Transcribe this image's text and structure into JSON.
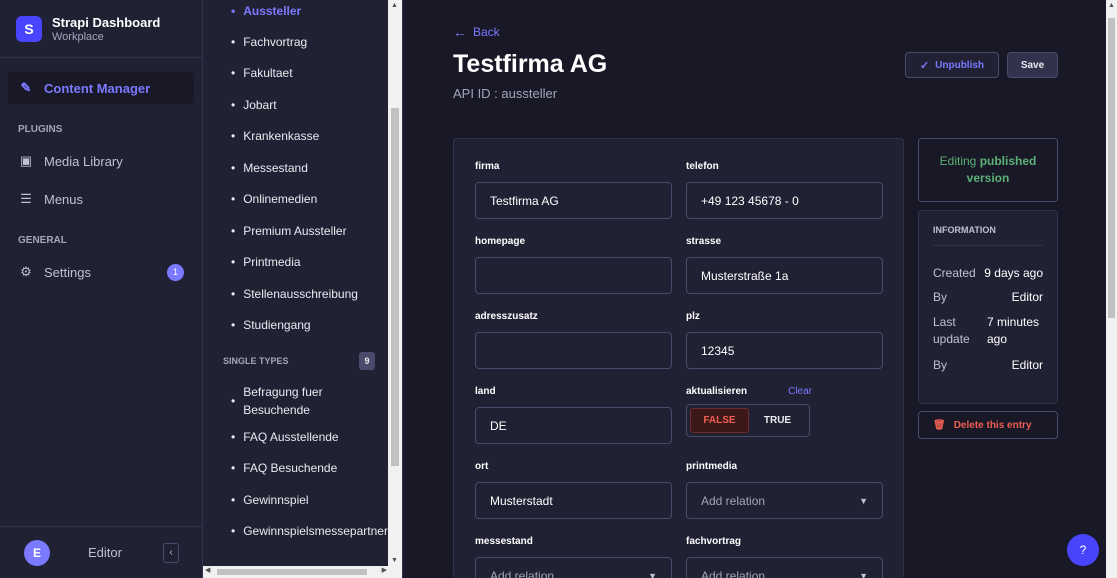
{
  "brand": {
    "logo_letter": "S",
    "title": "Strapi Dashboard",
    "subtitle": "Workplace"
  },
  "mainnav": {
    "content_manager": "Content Manager",
    "plugins_heading": "PLUGINS",
    "media_library": "Media Library",
    "menus": "Menus",
    "general_heading": "GENERAL",
    "settings": "Settings",
    "settings_badge": "1"
  },
  "footer": {
    "avatar_letter": "E",
    "user_name": "Editor",
    "collapse_icon": "‹"
  },
  "subnav": {
    "collection_items": [
      "Aussteller",
      "Fachvortrag",
      "Fakultaet",
      "Jobart",
      "Krankenkasse",
      "Messestand",
      "Onlinemedien",
      "Premium Aussteller",
      "Printmedia",
      "Stellenausschreibung",
      "Studiengang"
    ],
    "single_types_heading": "SINGLE TYPES",
    "single_types_count": "9",
    "single_items": [
      "Befragung fuer Besuchende",
      "FAQ Ausstellende",
      "FAQ Besuchende",
      "Gewinnspiel",
      "Gewinnspielsmessepartner"
    ]
  },
  "header": {
    "back": "Back",
    "title": "Testfirma AG",
    "api_id": "API ID : aussteller",
    "unpublish": "Unpublish",
    "save": "Save"
  },
  "form": {
    "firma": {
      "label": "firma",
      "value": "Testfirma AG"
    },
    "telefon": {
      "label": "telefon",
      "value": "+49 123 45678 - 0"
    },
    "homepage": {
      "label": "homepage",
      "value": ""
    },
    "strasse": {
      "label": "strasse",
      "value": "Musterstraße 1a"
    },
    "adresszusatz": {
      "label": "adresszusatz",
      "value": ""
    },
    "plz": {
      "label": "plz",
      "value": "12345"
    },
    "land": {
      "label": "land",
      "value": "DE"
    },
    "aktualisieren": {
      "label": "aktualisieren",
      "clear": "Clear",
      "false_label": "FALSE",
      "true_label": "TRUE",
      "value": false
    },
    "ort": {
      "label": "ort",
      "value": "Musterstadt"
    },
    "printmedia": {
      "label": "printmedia",
      "placeholder": "Add relation"
    },
    "messestand": {
      "label": "messestand",
      "placeholder": "Add relation"
    },
    "fachvortrag": {
      "label": "fachvortrag",
      "placeholder": "Add relation"
    }
  },
  "sidebar": {
    "editing_prefix": "Editing",
    "editing_strong": "published",
    "editing_suffix": "version",
    "info_heading": "INFORMATION",
    "created_label": "Created",
    "created_value": "9 days ago",
    "by_label": "By",
    "by_value": "Editor",
    "last_update_label": "Last update",
    "last_update_value": "7 minutes ago",
    "by2_label": "By",
    "by2_value": "Editor",
    "delete": "Delete this entry"
  },
  "help": "?",
  "colors": {
    "accent": "#7b79ff",
    "danger": "#ee5e52",
    "success": "#5cb176",
    "background": "#181826",
    "panel": "#212134"
  }
}
